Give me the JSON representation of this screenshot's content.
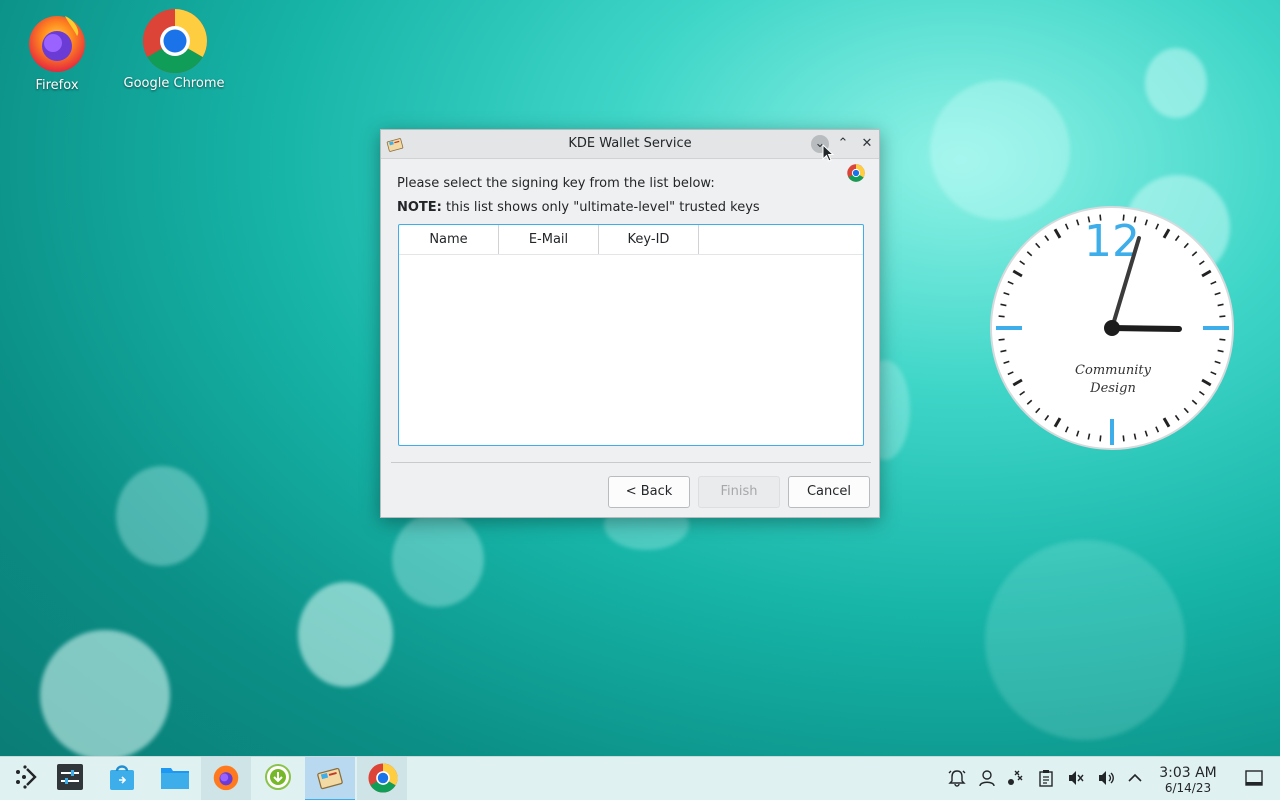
{
  "desktop": {
    "icons": [
      {
        "label": "Firefox",
        "icon": "firefox-icon"
      },
      {
        "label": "Google Chrome",
        "icon": "chrome-icon"
      }
    ],
    "clock_widget": {
      "twelve_label": "12",
      "brand_line1": "Community",
      "brand_line2": "Design",
      "time": "3:03"
    }
  },
  "dialog": {
    "title": "KDE Wallet Service",
    "message": "Please select the signing key from the list below:",
    "note_label": "NOTE:",
    "note_text": " this list shows only \"ultimate-level\" trusted keys",
    "columns": [
      "Name",
      "E-Mail",
      "Key-ID"
    ],
    "rows": [],
    "buttons": {
      "back": "< Back",
      "finish": "Finish",
      "cancel": "Cancel"
    },
    "finish_enabled": false
  },
  "taskbar": {
    "launcher_items": [
      "app-launcher-icon",
      "system-settings-icon",
      "discover-icon",
      "file-manager-icon",
      "firefox-icon",
      "download-icon",
      "kwallet-icon",
      "chrome-icon"
    ],
    "tray_icons": [
      "notifications-icon",
      "user-icon",
      "network-icon",
      "clipboard-icon",
      "mute-icon",
      "volume-icon",
      "expand-tray-icon"
    ],
    "time": "3:03 AM",
    "date": "6/14/23"
  },
  "colors": {
    "accent": "#3daee9",
    "taskbar_bg": "#e0f1f2"
  }
}
